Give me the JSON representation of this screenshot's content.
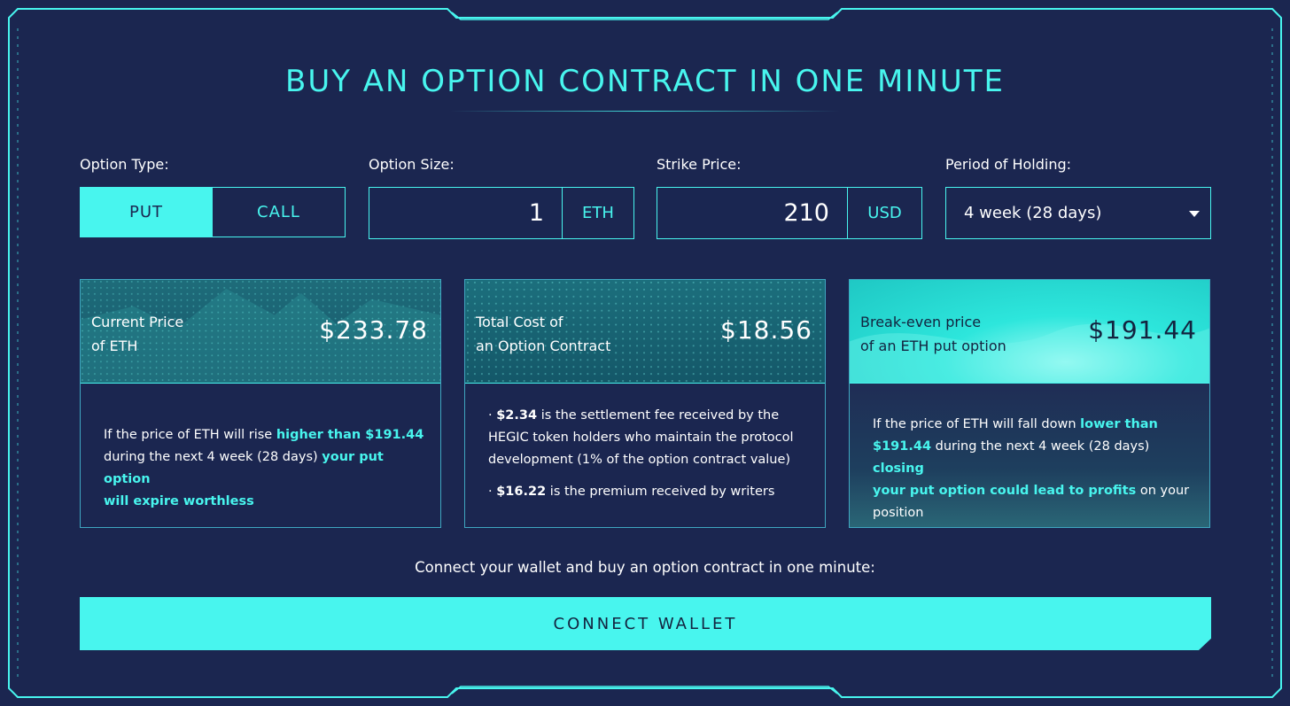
{
  "title": "BUY AN OPTION CONTRACT IN ONE MINUTE",
  "colors": {
    "accent": "#48f5ee",
    "background": "#1b2650",
    "dark_text": "#13233f"
  },
  "form": {
    "option_type": {
      "label": "Option Type:",
      "put": "PUT",
      "call": "CALL",
      "selected": "PUT"
    },
    "option_size": {
      "label": "Option Size:",
      "value": "1",
      "unit": "ETH"
    },
    "strike_price": {
      "label": "Strike Price:",
      "value": "210",
      "unit": "USD"
    },
    "period": {
      "label": "Period of Holding:",
      "value": "4 week (28 days)",
      "icon": "chevron-down-icon"
    }
  },
  "cards": [
    {
      "label_line1": "Current Price",
      "label_line2": "of ETH",
      "value": "$233.78",
      "body": [
        "If the price of ETH will rise ",
        "higher than $191.44",
        "during the next 4 week (28 days) ",
        "your put option",
        "will expire worthless"
      ]
    },
    {
      "label_line1": "Total Cost of",
      "label_line2": "an Option Contract",
      "value": "$18.56",
      "bullet1_amount": "$2.34",
      "bullet1_line1": " is the settlement fee received by the",
      "bullet1_line2": "HEGIC token holders who maintain the protocol",
      "bullet1_line3": "development (1% of the option contract value)",
      "bullet2_amount": "$16.22",
      "bullet2_text": " is the premium received by writers",
      "bullet_char": "·"
    },
    {
      "label_line1": "Break-even price",
      "label_line2": "of an ETH put option",
      "value": "$191.44",
      "body": [
        "If the price of ETH will fall down ",
        "lower than",
        "$191.44",
        " during the next 4 week (28 days) ",
        "closing",
        "your put option could lead to profits",
        " on your",
        "position"
      ]
    }
  ],
  "connect": {
    "caption": "Connect your wallet and buy an option contract in one minute:",
    "button": "CONNECT WALLET"
  }
}
